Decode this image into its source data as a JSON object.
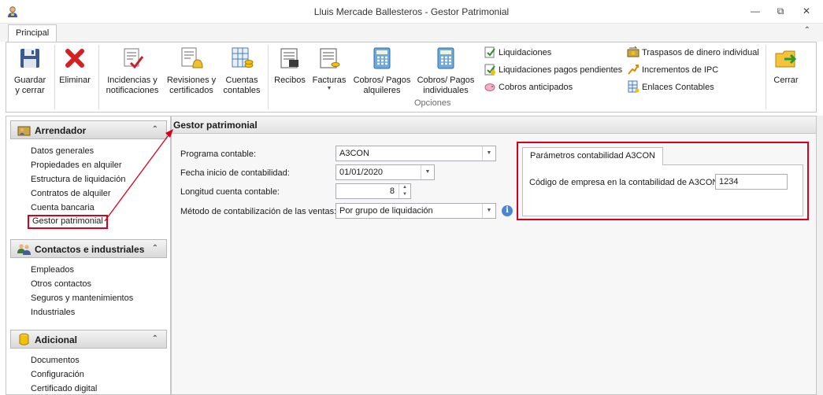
{
  "window": {
    "title": "Lluis Mercade Ballesteros - Gestor Patrimonial",
    "icons": [
      "app-user-icon",
      "minimize-icon",
      "maximize-icon",
      "close-icon"
    ]
  },
  "ribbon": {
    "tab_label": "Principal",
    "collapse_icon": "chevron-up-icon",
    "buttons": {
      "guardar": {
        "line1": "Guardar",
        "line2": "y cerrar",
        "icon": "floppy-disk-icon"
      },
      "eliminar": {
        "line1": "Eliminar",
        "icon": "red-x-icon"
      },
      "incidencias": {
        "line1": "Incidencias y",
        "line2": "notificaciones",
        "icon": "incident-check-icon"
      },
      "revisiones": {
        "line1": "Revisiones y",
        "line2": "certificados",
        "icon": "bell-certificate-icon"
      },
      "cuentas": {
        "line1": "Cuentas",
        "line2": "contables",
        "icon": "ledger-coins-icon"
      },
      "recibos": {
        "line1": "Recibos",
        "icon": "receipt-icon"
      },
      "facturas": {
        "line1": "Facturas",
        "icon": "invoice-icon"
      },
      "cobros_alquileres": {
        "line1": "Cobros/ Pagos",
        "line2": "alquileres",
        "icon": "calculator-icon"
      },
      "cobros_individuales": {
        "line1": "Cobros/ Pagos",
        "line2": "individuales",
        "icon": "calculator-icon"
      },
      "cerrar": {
        "line1": "Cerrar",
        "icon": "exit-folder-icon"
      }
    },
    "small_items": {
      "liquidaciones": "Liquidaciones",
      "liquidaciones_pendientes": "Liquidaciones pagos pendientes",
      "cobros_anticipados": "Cobros anticipados",
      "traspasos": "Traspasos de dinero individual",
      "incrementos": "Incrementos de IPC",
      "enlaces": "Enlaces Contables"
    },
    "group_label": "Opciones"
  },
  "sidebar": {
    "sections": [
      {
        "title": "Arrendador",
        "icon": "landlord-icon",
        "items": [
          "Datos generales",
          "Propiedades en alquiler",
          "Estructura de liquidación",
          "Contratos de alquiler",
          "Cuenta bancaria",
          "Gestor patrimonial"
        ]
      },
      {
        "title": "Contactos e industriales",
        "icon": "contacts-icon",
        "items": [
          "Empleados",
          "Otros contactos",
          "Seguros y mantenimientos",
          "Industriales"
        ]
      },
      {
        "title": "Adicional",
        "icon": "database-icon",
        "items": [
          "Documentos",
          "Configuración",
          "Certificado digital"
        ]
      }
    ],
    "selected": "Gestor patrimonial"
  },
  "main": {
    "header": "Gestor patrimonial",
    "fields": {
      "programa": {
        "label": "Programa contable:",
        "value": "A3CON"
      },
      "fecha": {
        "label": "Fecha inicio de contabilidad:",
        "value": "01/01/2020"
      },
      "longitud": {
        "label": "Longitud cuenta contable:",
        "value": "8"
      },
      "metodo": {
        "label": "Método de contabilización de las ventas:",
        "value": "Por grupo de liquidación"
      }
    },
    "params": {
      "tab_label": "Parámetros contabilidad A3CON",
      "empresa_label": "Código de empresa en la contabilidad de A3CON",
      "empresa_value": "1234"
    }
  },
  "colors": {
    "highlight_red": "#d9001b",
    "border": "#c6c6c6",
    "info_blue": "#4a86d4"
  }
}
